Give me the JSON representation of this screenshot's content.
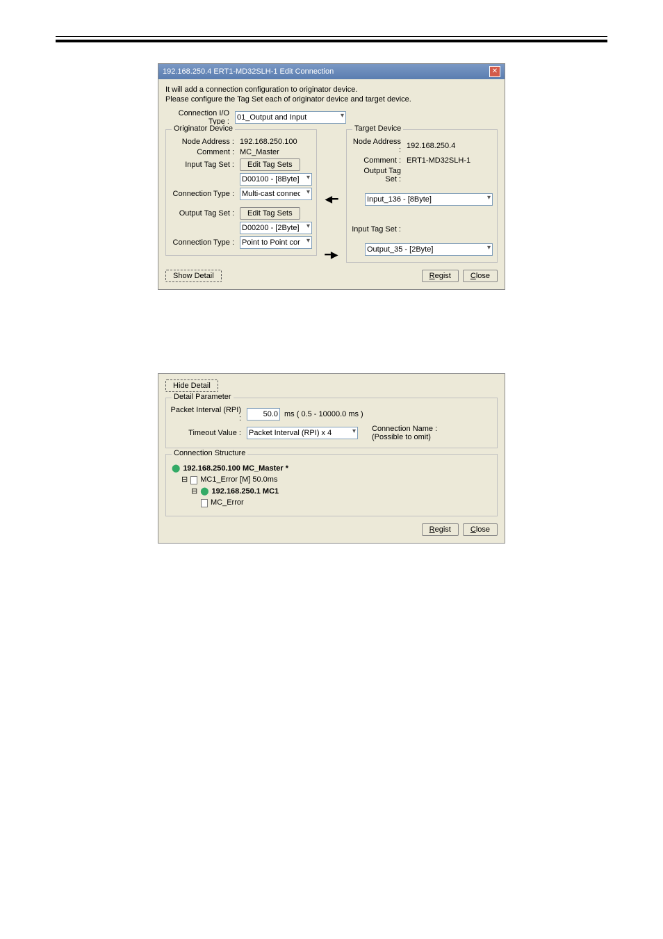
{
  "dialog1": {
    "title": "192.168.250.4 ERT1-MD32SLH-1 Edit Connection",
    "intro_line1": "It will add a connection configuration to originator device.",
    "intro_line2": "Please configure the Tag Set each of originator device and target device.",
    "conn_io_type_label": "Connection I/O Type :",
    "conn_io_type_value": "01_Output and Input",
    "originator": {
      "group_title": "Originator Device",
      "node_addr_label": "Node Address :",
      "node_addr_value": "192.168.250.100",
      "comment_label": "Comment :",
      "comment_value": "MC_Master",
      "input_tag_label": "Input Tag Set :",
      "edit_tag_btn": "Edit Tag Sets",
      "input_tag_value": "D00100 - [8Byte]",
      "conn_type_label": "Connection Type :",
      "conn_type_value": "Multi-cast connection",
      "output_tag_label": "Output Tag Set :",
      "edit_tag_btn2": "Edit Tag Sets",
      "output_tag_value": "D00200 - [2Byte]",
      "conn_type2_label": "Connection Type :",
      "conn_type2_value": "Point to Point connection"
    },
    "target": {
      "group_title": "Target Device",
      "node_addr_label": "Node Address :",
      "node_addr_value": "192.168.250.4",
      "comment_label": "Comment :",
      "comment_value": "ERT1-MD32SLH-1",
      "output_tag_label": "Output Tag Set :",
      "output_tag_value": "Input_136 - [8Byte]",
      "input_tag_label": "Input Tag Set :",
      "input_tag_value": "Output_35 - [2Byte]"
    },
    "show_detail_btn": "Show Detail",
    "regist_btn": "Regist",
    "close_btn": "Close"
  },
  "dialog2": {
    "hide_detail_btn": "Hide Detail",
    "detail_group": "Detail Parameter",
    "rpi_label": "Packet Interval (RPI) :",
    "rpi_value": "50.0",
    "rpi_unit": "ms ( 0.5 - 10000.0 ms )",
    "timeout_label": "Timeout Value :",
    "timeout_value": "Packet Interval (RPI) x 4",
    "conn_name_label": "Connection Name :",
    "conn_name_sub": "(Possible to omit)",
    "conn_struct_group": "Connection Structure",
    "tree": {
      "n1": "192.168.250.100 MC_Master *",
      "n2": "MC1_Error [M] 50.0ms",
      "n3": "192.168.250.1 MC1",
      "n4": "MC_Error"
    },
    "regist_btn": "Regist",
    "close_btn": "Close"
  }
}
